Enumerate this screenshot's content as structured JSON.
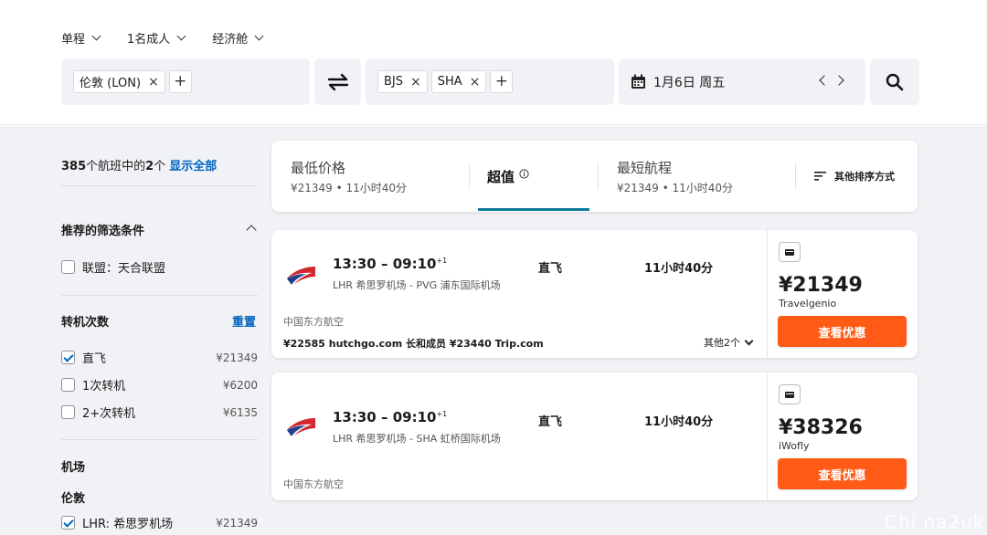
{
  "trip": {
    "type": "单程",
    "passengers": "1名成人",
    "cabin": "经济舱"
  },
  "search": {
    "origin_chips": [
      "伦敦 (LON)"
    ],
    "destination_chips": [
      "BJS",
      "SHA"
    ],
    "date": "1月6日 周五",
    "remove_glyph": "×",
    "add_glyph": "+"
  },
  "sidebar": {
    "count_prefix": "385",
    "count_middle": "个航班中的",
    "count_shown": "2",
    "count_suffix": "个",
    "show_all": "显示全部",
    "recommended_title": "推荐的筛选条件",
    "alliance_label": "联盟：天合联盟",
    "stops_title": "转机次数",
    "reset": "重置",
    "stops": [
      {
        "label": "直飞",
        "price": "¥21349",
        "checked": true
      },
      {
        "label": "1次转机",
        "price": "¥6200",
        "checked": false
      },
      {
        "label": "2+次转机",
        "price": "¥6135",
        "checked": false
      }
    ],
    "airport_title": "机场",
    "city_title": "伦敦",
    "airports": [
      {
        "label": "LHR: 希思罗机场",
        "price": "¥21349",
        "checked": true
      }
    ]
  },
  "sort_tabs": [
    {
      "title": "最低价格",
      "sub": "¥21349 • 11小时40分"
    },
    {
      "title": "超值",
      "sub": ""
    },
    {
      "title": "最短航程",
      "sub": "¥21349 • 11小时40分"
    }
  ],
  "sort_other": "其他排序方式",
  "results": [
    {
      "depart": "13:30",
      "arrive": "09:10",
      "day_offset": "+1",
      "route": "LHR 希思罗机场 - PVG 浦东国际机场",
      "stops": "直飞",
      "duration": "11小时40分",
      "airline": "中国东方航空",
      "other_offers": "¥22585 hutchgo.com 长和成员  ¥23440 Trip.com",
      "more": "其他2个",
      "price": "¥21349",
      "provider": "Travelgenio",
      "button": "查看优惠"
    },
    {
      "depart": "13:30",
      "arrive": "09:10",
      "day_offset": "+1",
      "route": "LHR 希思罗机场 - SHA 虹桥国际机场",
      "stops": "直飞",
      "duration": "11小时40分",
      "airline": "中国东方航空",
      "other_offers": "",
      "more": "",
      "price": "¥38326",
      "provider": "iWofly",
      "button": "查看优惠"
    }
  ],
  "watermark": "Chi na2uk",
  "colors": {
    "accent": "#0064c0",
    "cta": "#ff5b16",
    "tab_underline": "#0b7a9b",
    "airline_red": "#d3282f",
    "airline_blue": "#1d3f8f"
  },
  "icons": [
    "chevron-down-icon",
    "swap-icon",
    "calendar-icon",
    "chevron-left-icon",
    "chevron-right-icon",
    "search-icon",
    "info-icon",
    "sort-icon",
    "baggage-icon",
    "china-eastern-logo"
  ]
}
